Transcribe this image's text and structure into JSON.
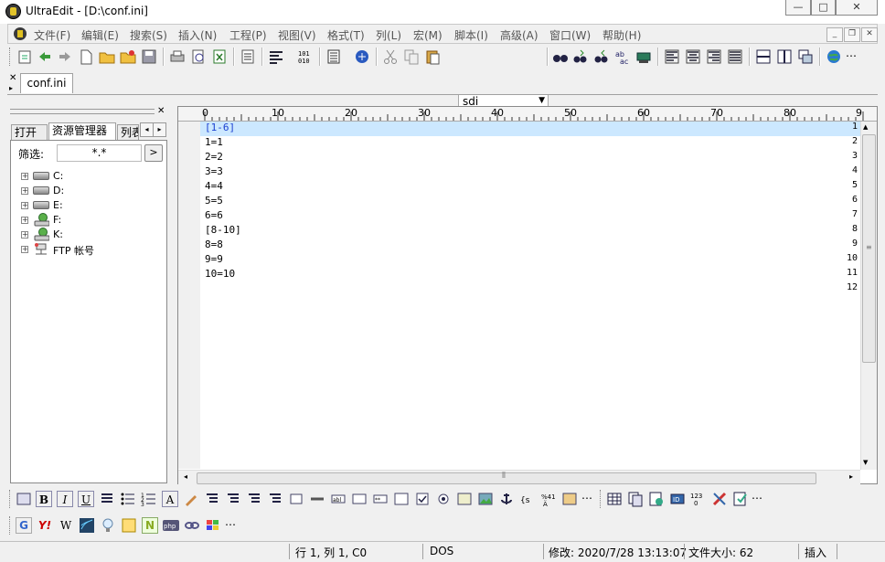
{
  "window": {
    "title": "UltraEdit - [D:\\conf.ini]",
    "controls": {
      "minimize": "▭",
      "maximize": "□",
      "close": "✕"
    }
  },
  "menubar": {
    "items": [
      "文件(F)",
      "编辑(E)",
      "搜索(S)",
      "插入(N)",
      "工程(P)",
      "视图(V)",
      "格式(T)",
      "列(L)",
      "宏(M)",
      "脚本(I)",
      "高级(A)",
      "窗口(W)",
      "帮助(H)"
    ],
    "mdi": {
      "minimize": "_",
      "restore": "❐",
      "close": "✕"
    }
  },
  "toolbar": {
    "search_combo_value": "sdi"
  },
  "tabs": {
    "open_file": "conf.ini"
  },
  "left_panel": {
    "tabs": [
      "打开",
      "资源管理器",
      "列表"
    ],
    "filter_label": "筛选:",
    "filter_value": "*.*",
    "filter_button": ">",
    "tree": [
      {
        "label": "C:",
        "icon": "hard-drive-icon"
      },
      {
        "label": "D:",
        "icon": "hard-drive-icon"
      },
      {
        "label": "E:",
        "icon": "hard-drive-icon"
      },
      {
        "label": "F:",
        "icon": "network-drive-icon"
      },
      {
        "label": "K:",
        "icon": "network-drive-icon"
      },
      {
        "label": "FTP 帐号",
        "icon": "ftp-account-icon"
      }
    ]
  },
  "editor": {
    "ruler_labels": [
      "0",
      "10",
      "20",
      "30",
      "40",
      "50",
      "60",
      "70",
      "80",
      "9"
    ],
    "lines": [
      "[1-6]",
      "1=1",
      "2=2",
      "3=3",
      "4=4",
      "5=5",
      "6=6",
      "[8-10]",
      "8=8",
      "9=9",
      "10=10",
      ""
    ],
    "line_numbers": [
      "1",
      "2",
      "3",
      "4",
      "5",
      "6",
      "7",
      "8",
      "9",
      "10",
      "11",
      "12"
    ],
    "highlight_color": "#cce8ff",
    "section_color": "#1a3fd0"
  },
  "statusbar": {
    "position": "行 1, 列 1, C0",
    "line_ending": "DOS",
    "modified": "修改: 2020/7/28 13:13:07",
    "file_size": "文件大小: 62",
    "mode": "插入"
  }
}
